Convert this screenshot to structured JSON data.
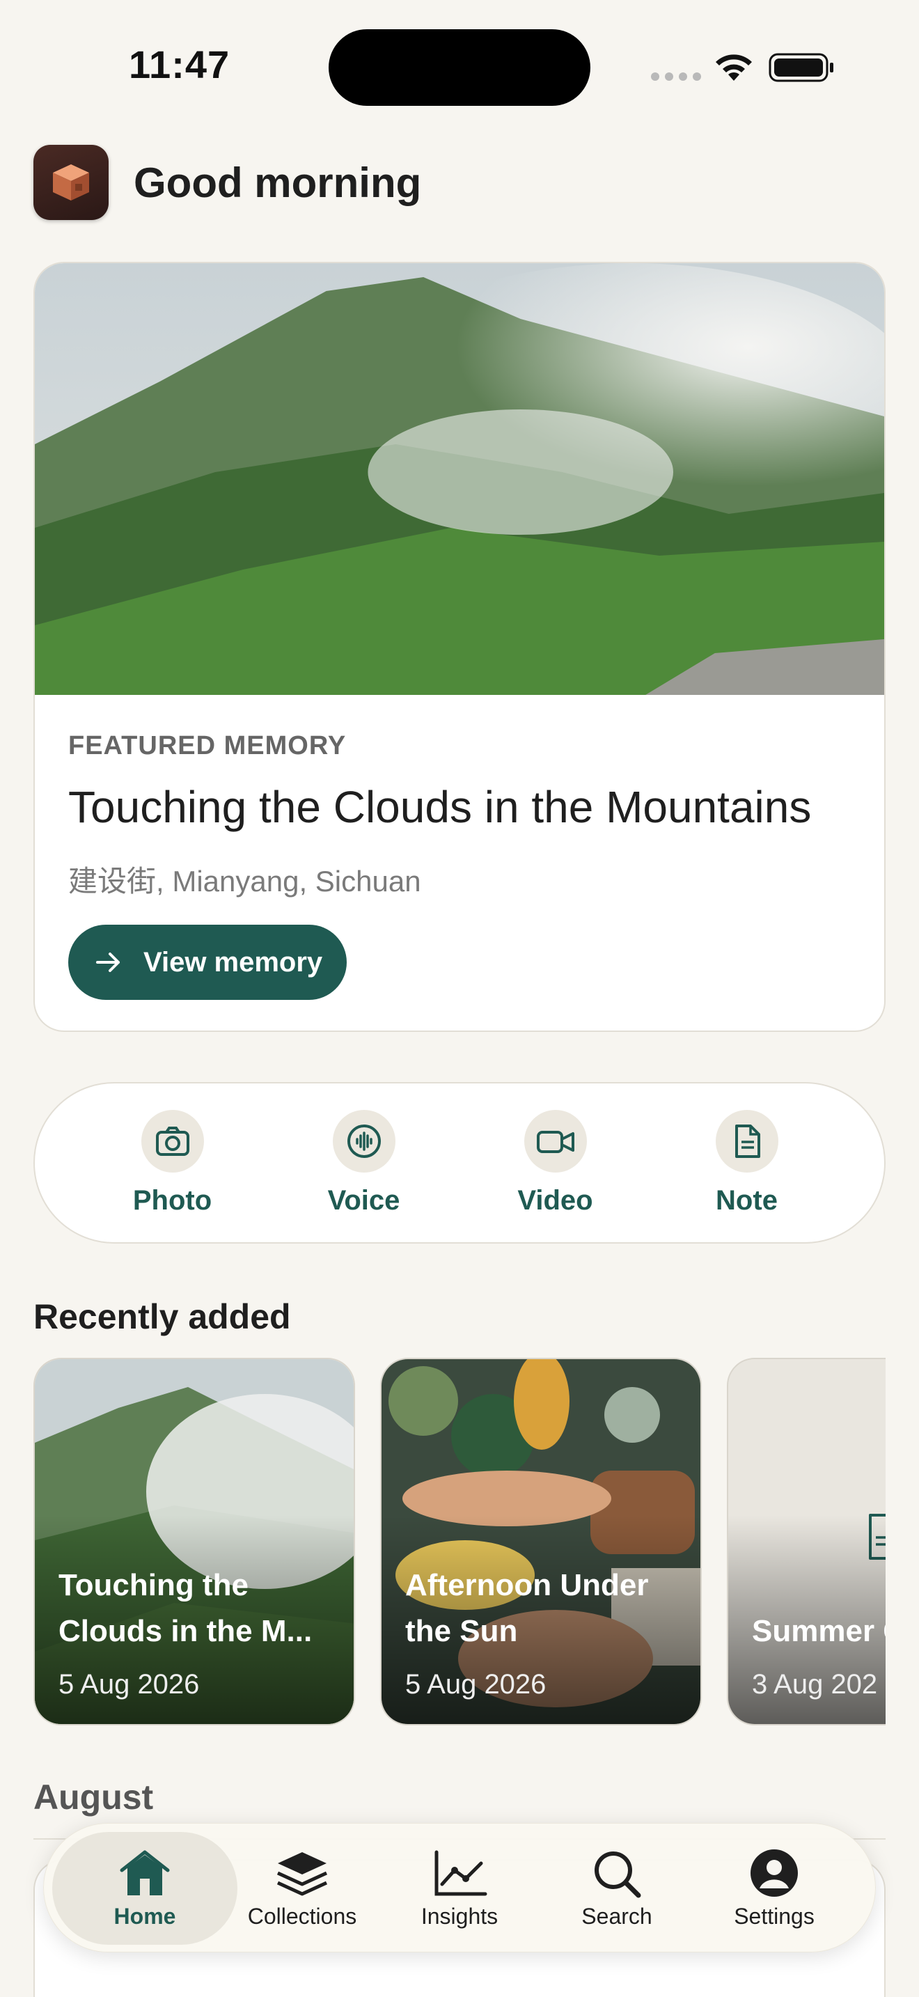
{
  "status_bar": {
    "time": "11:47"
  },
  "header": {
    "greeting": "Good morning"
  },
  "featured": {
    "kicker": "FEATURED MEMORY",
    "title": "Touching the Clouds in the Mountains",
    "location": "建设街, Mianyang, Sichuan",
    "button_label": "View memory"
  },
  "quick_actions": [
    {
      "label": "Photo",
      "icon": "camera-icon"
    },
    {
      "label": "Voice",
      "icon": "voice-icon"
    },
    {
      "label": "Video",
      "icon": "video-icon"
    },
    {
      "label": "Note",
      "icon": "note-icon"
    }
  ],
  "recent": {
    "title": "Recently added",
    "items": [
      {
        "title": "Touching the Clouds in the M...",
        "date": "5 Aug 2026"
      },
      {
        "title": "Afternoon Under the Sun",
        "date": "5 Aug 2026"
      },
      {
        "title": "Summer Cheese F",
        "date": "3 Aug 202"
      }
    ]
  },
  "august": {
    "title": "August"
  },
  "tabbar": {
    "active": "Home",
    "tabs": [
      {
        "label": "Home",
        "icon": "home-icon"
      },
      {
        "label": "Collections",
        "icon": "layers-icon"
      },
      {
        "label": "Insights",
        "icon": "chart-icon"
      },
      {
        "label": "Search",
        "icon": "search-icon"
      },
      {
        "label": "Settings",
        "icon": "profile-icon"
      }
    ]
  },
  "colors": {
    "accent": "#1f5a52",
    "background": "#f7f5f0"
  }
}
